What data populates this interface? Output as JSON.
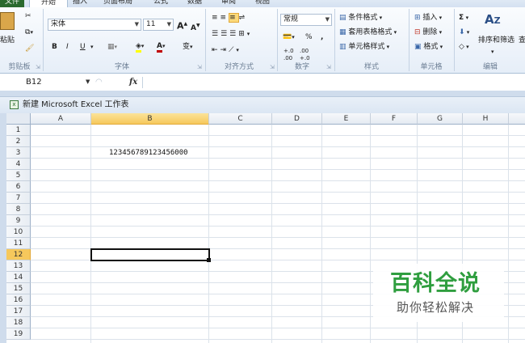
{
  "tabs": [
    "文件",
    "开始",
    "插入",
    "页面布局",
    "公式",
    "数据",
    "审阅",
    "视图"
  ],
  "ribbon": {
    "clipboard": {
      "paste": "粘贴",
      "cut_icon": "scissors-icon",
      "copy_icon": "copy-icon",
      "format_painter_icon": "brush-icon",
      "label": "剪贴板"
    },
    "font": {
      "name": "宋体",
      "size": "11",
      "grow": "A",
      "shrink": "A",
      "bold": "B",
      "italic": "I",
      "underline": "U",
      "phonetic": "变",
      "label": "字体",
      "fill_color": "#ffff00",
      "font_color": "#c00000"
    },
    "alignment": {
      "label": "对齐方式"
    },
    "number": {
      "format": "常规",
      "percent": "%",
      "comma": ",",
      "inc_decimal": "+.0 .00",
      "dec_decimal": ".00 +.0",
      "label": "数字"
    },
    "styles": {
      "conditional": "条件格式",
      "table": "套用表格格式",
      "cell_styles": "单元格样式",
      "label": "样式"
    },
    "cells": {
      "insert": "插入",
      "delete": "删除",
      "format": "格式",
      "label": "单元格"
    },
    "editing": {
      "sum": "Σ",
      "sort_filter": "排序和筛选",
      "find": "查",
      "label": "编辑"
    }
  },
  "formula_bar": {
    "name_box": "B12",
    "fx": "fx",
    "value": ""
  },
  "workbook": {
    "title": "新建 Microsoft Excel 工作表"
  },
  "sheet": {
    "columns": [
      "A",
      "B",
      "C",
      "D",
      "E",
      "F",
      "G",
      "H",
      "I"
    ],
    "rows": [
      "1",
      "2",
      "3",
      "4",
      "5",
      "6",
      "7",
      "8",
      "9",
      "10",
      "11",
      "12",
      "13",
      "14",
      "15",
      "16",
      "17",
      "18",
      "19"
    ],
    "selected_column": "B",
    "selected_row": "12",
    "cells": {
      "B3": "123456789123456000"
    }
  },
  "watermark": {
    "title": "百科全说",
    "subtitle": "助你轻松解决",
    "color": "#2f9e3f"
  },
  "colors": {
    "selection_header": "#f6c85c",
    "excel_green": "#2a6a2e"
  }
}
